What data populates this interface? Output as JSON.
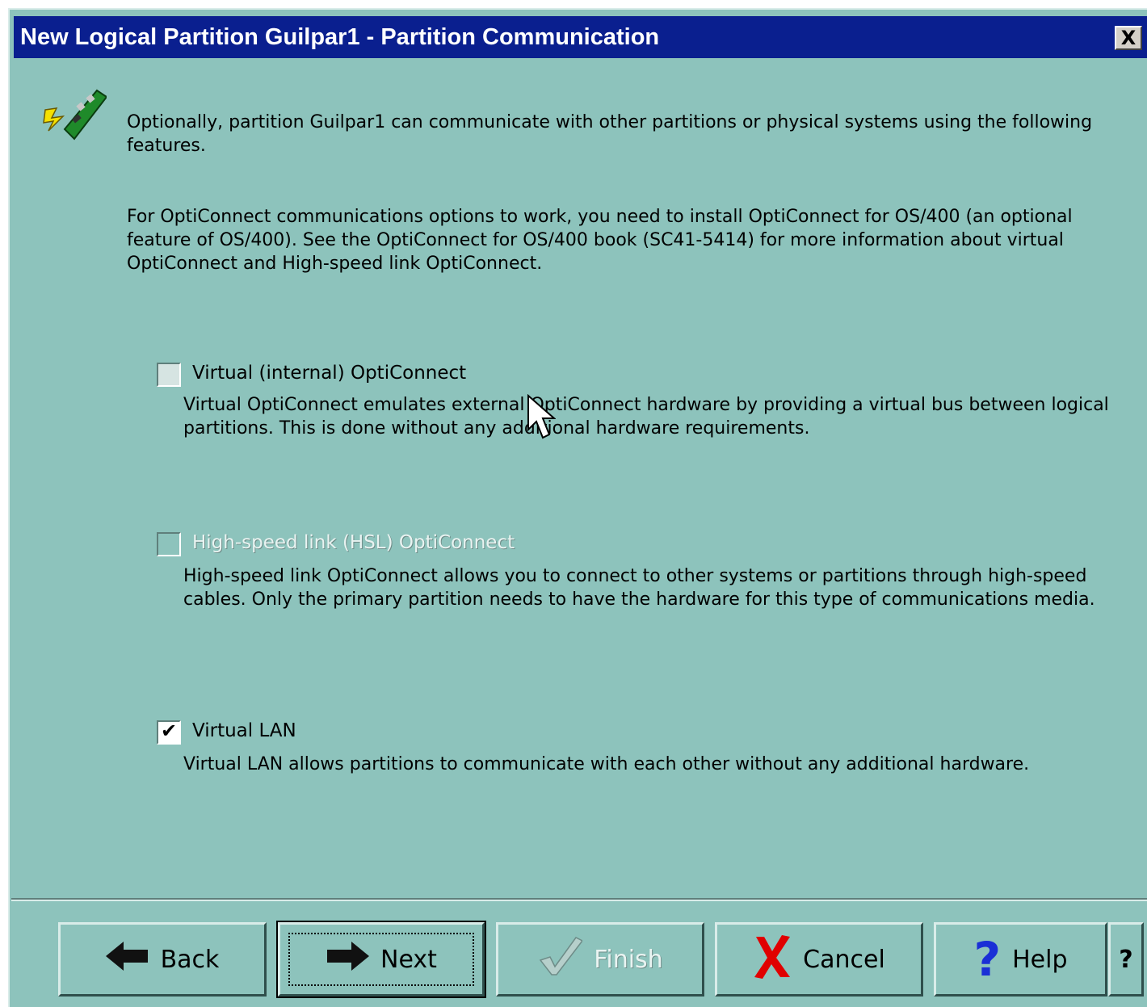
{
  "window": {
    "title": "New Logical Partition Guilpar1 - Partition Communication",
    "close_label": "X"
  },
  "intro": {
    "icon": "lan-card-icon",
    "text1": "Optionally, partition Guilpar1 can communicate with other partitions or physical systems using the following features.",
    "text2": "For OptiConnect communications options to work, you need to install OptiConnect for OS/400 (an optional feature of OS/400). See the OptiConnect for OS/400 book (SC41-5414) for more information about virtual OptiConnect and High-speed link OptiConnect."
  },
  "options": [
    {
      "label": "Virtual (internal) OptiConnect",
      "checked": false,
      "enabled": true,
      "description": "Virtual OptiConnect emulates external OptiConnect hardware by providing a virtual bus between logical partitions. This is done without any additional hardware requirements."
    },
    {
      "label": "High-speed link (HSL) OptiConnect",
      "checked": false,
      "enabled": false,
      "description": "High-speed link OptiConnect allows you to connect to other systems or partitions through high-speed cables. Only the primary partition needs to have the hardware for this type of communications media."
    },
    {
      "label": "Virtual LAN",
      "checked": true,
      "enabled": true,
      "description": "Virtual LAN allows partitions to communicate with each other without any additional hardware."
    }
  ],
  "buttons": {
    "back": "Back",
    "next": "Next",
    "finish": "Finish",
    "cancel": "Cancel",
    "help": "Help",
    "whats_this": "?"
  },
  "colors": {
    "background": "#8dc3bc",
    "title_bar": "#0a1f8f"
  }
}
